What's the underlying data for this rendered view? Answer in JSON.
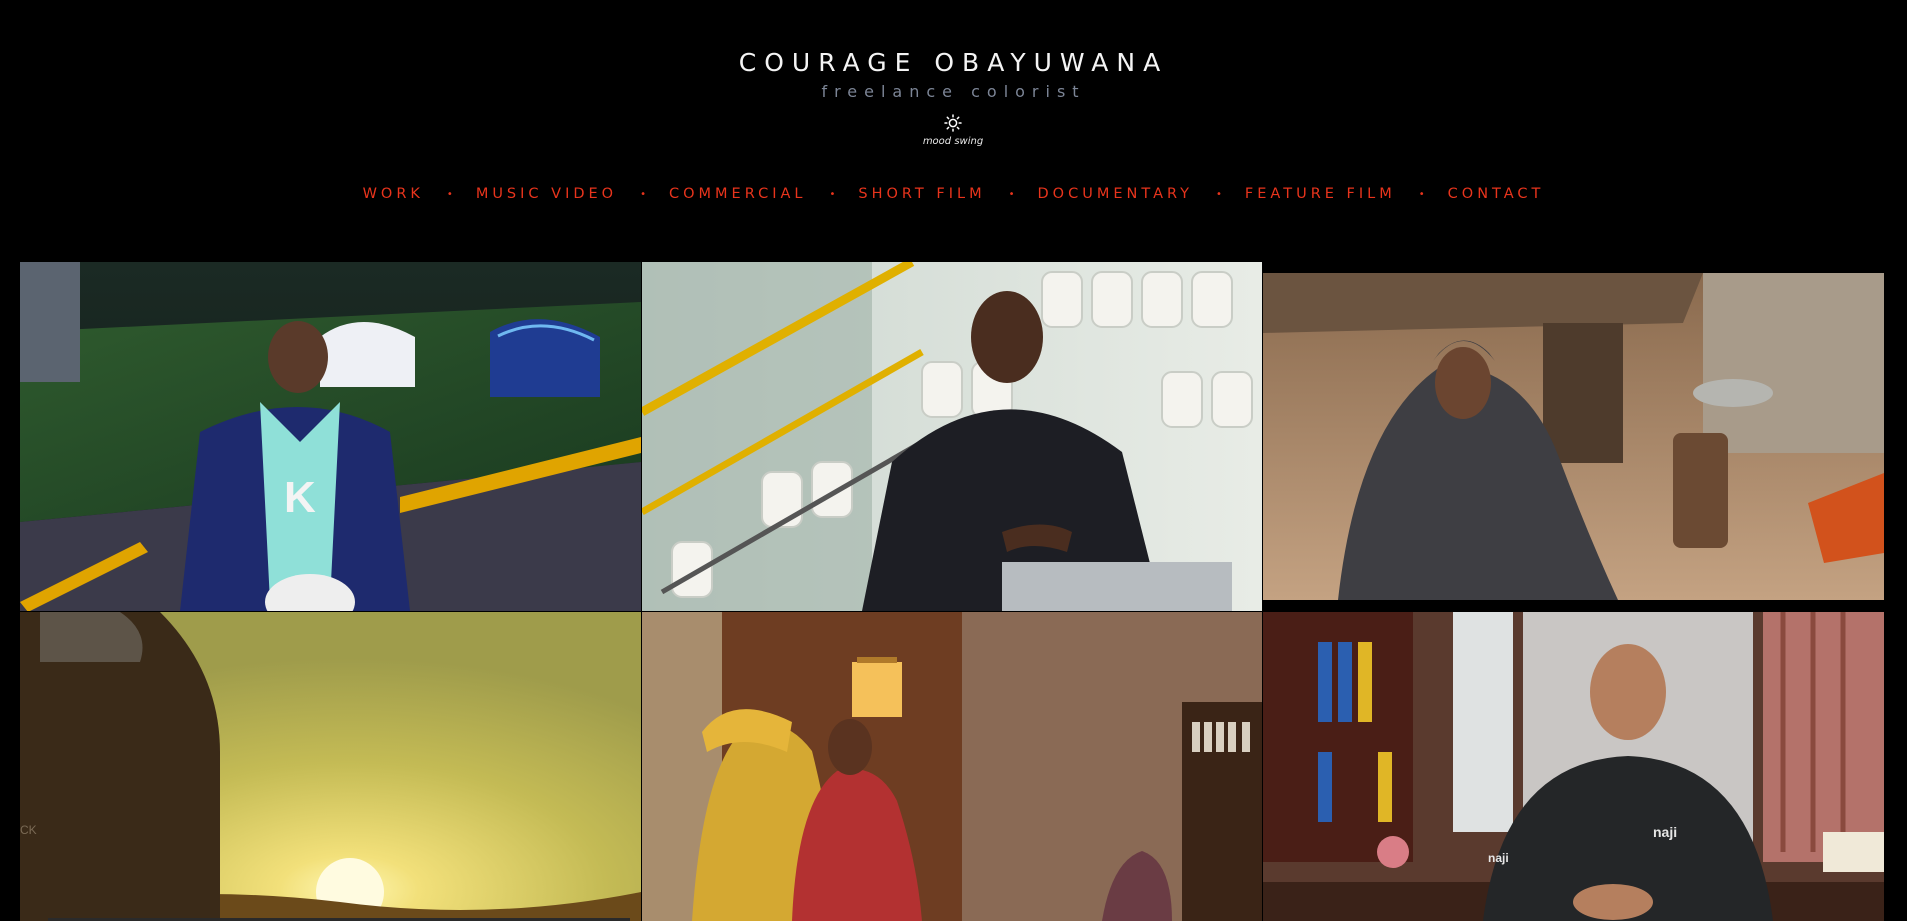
{
  "header": {
    "title": "COURAGE OBAYUWANA",
    "subtitle": "freelance colorist",
    "mode_toggle_label": "mood swing",
    "mode_toggle_icon": "sun-icon"
  },
  "nav": {
    "items": [
      {
        "label": "WORK"
      },
      {
        "label": "MUSIC VIDEO"
      },
      {
        "label": "COMMERCIAL"
      },
      {
        "label": "SHORT FILM"
      },
      {
        "label": "DOCUMENTARY"
      },
      {
        "label": "FEATURE FILM"
      },
      {
        "label": "CONTACT"
      }
    ],
    "separator": "•"
  },
  "colors": {
    "background": "#000000",
    "title": "#f4f4f4",
    "subtitle": "#7c8596",
    "nav_accent": "#e8341c"
  },
  "grid": {
    "tiles": [
      {
        "name": "stadium-jersey-still",
        "jersey_letter": "K"
      },
      {
        "name": "stadium-seats-still"
      },
      {
        "name": "village-hijab-still"
      },
      {
        "name": "sunset-silhouette-still"
      },
      {
        "name": "vintage-interior-still"
      },
      {
        "name": "office-interview-still",
        "logo_text": "naji"
      }
    ]
  }
}
